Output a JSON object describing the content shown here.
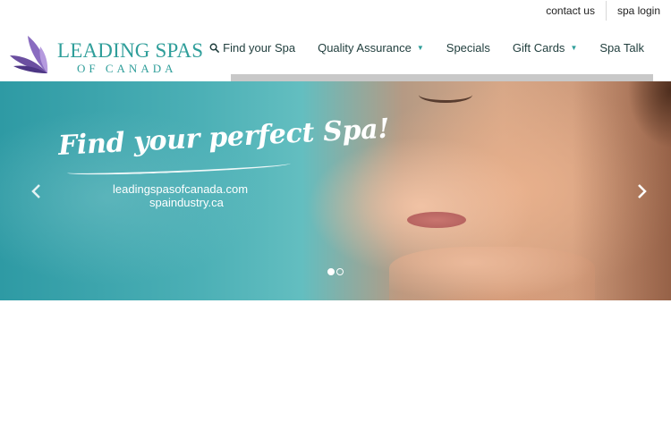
{
  "utility_nav": {
    "contact_label": "contact us",
    "login_label": "spa login"
  },
  "logo": {
    "line1": "LEADING SPAS",
    "line2": "OF CANADA",
    "mark_icon": "lotus-petals-icon",
    "color": "#2f9e9a",
    "mark_color": "#6b4fa0"
  },
  "main_nav": {
    "items": [
      {
        "label": "Find your Spa",
        "icon": "search-icon",
        "dropdown": false
      },
      {
        "label": "Quality Assurance",
        "dropdown": true
      },
      {
        "label": "Specials",
        "dropdown": false
      },
      {
        "label": "Gift Cards",
        "dropdown": true
      },
      {
        "label": "Spa Talk",
        "dropdown": false
      }
    ]
  },
  "hero": {
    "headline": "Find your perfect Spa!",
    "url1": "leadingspasofcanada.com",
    "url2": "spaindustry.ca",
    "prev_icon": "chevron-left-icon",
    "next_icon": "chevron-right-icon",
    "slides_total": 2,
    "active_slide": 1
  }
}
